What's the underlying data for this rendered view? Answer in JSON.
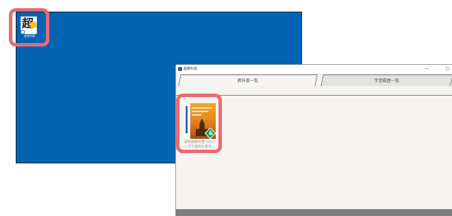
{
  "desktop": {
    "shortcut_icon": "app-shortcut-icon",
    "shortcut_glyph": "超",
    "shortcut_label": "超教科書",
    "background_color": "#0563b4"
  },
  "highlight_color": "#e86a73",
  "window": {
    "title": "超教科書",
    "minimize_glyph": "—",
    "close_glyph": "□",
    "tabs": [
      {
        "label": "教科書一覧",
        "active": true
      },
      {
        "label": "学習履歴一覧",
        "active": false
      }
    ]
  },
  "book": {
    "cover_icon": "textbook-cover-image",
    "badge_glyph": "&",
    "caption": "最新版教科書へのリ\nンクや資料を表示..."
  }
}
